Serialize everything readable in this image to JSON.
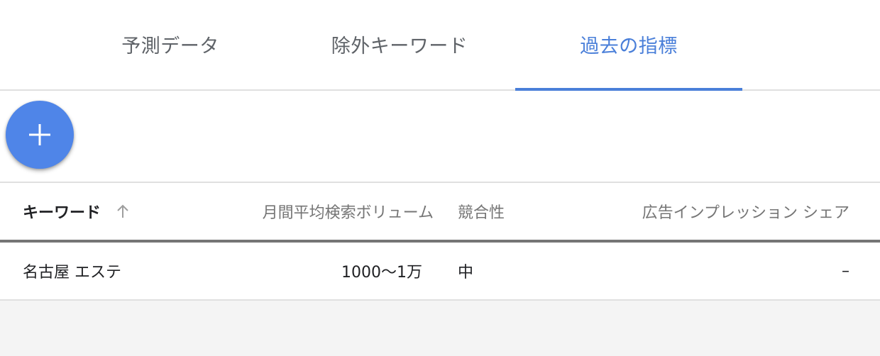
{
  "tabs": [
    {
      "label": "予測データ",
      "active": false
    },
    {
      "label": "除外キーワード",
      "active": false
    },
    {
      "label": "過去の指標",
      "active": true
    }
  ],
  "colors": {
    "accent": "#4a7fd9",
    "fab": "#4f85e8",
    "header_text": "#757575",
    "body_text": "#202124",
    "lower_background": "#f4f4f4"
  },
  "fab": {
    "icon": "plus-icon"
  },
  "table": {
    "columns": {
      "keyword": "キーワード",
      "keyword_sort_icon": "arrow-up-icon",
      "volume": "月間平均検索ボリューム",
      "competition": "競合性",
      "impression_share": "広告インプレッション シェア"
    },
    "rows": [
      {
        "keyword": "名古屋 エステ",
        "volume": "1000～1万",
        "competition": "中",
        "impression_share": "–"
      }
    ]
  }
}
